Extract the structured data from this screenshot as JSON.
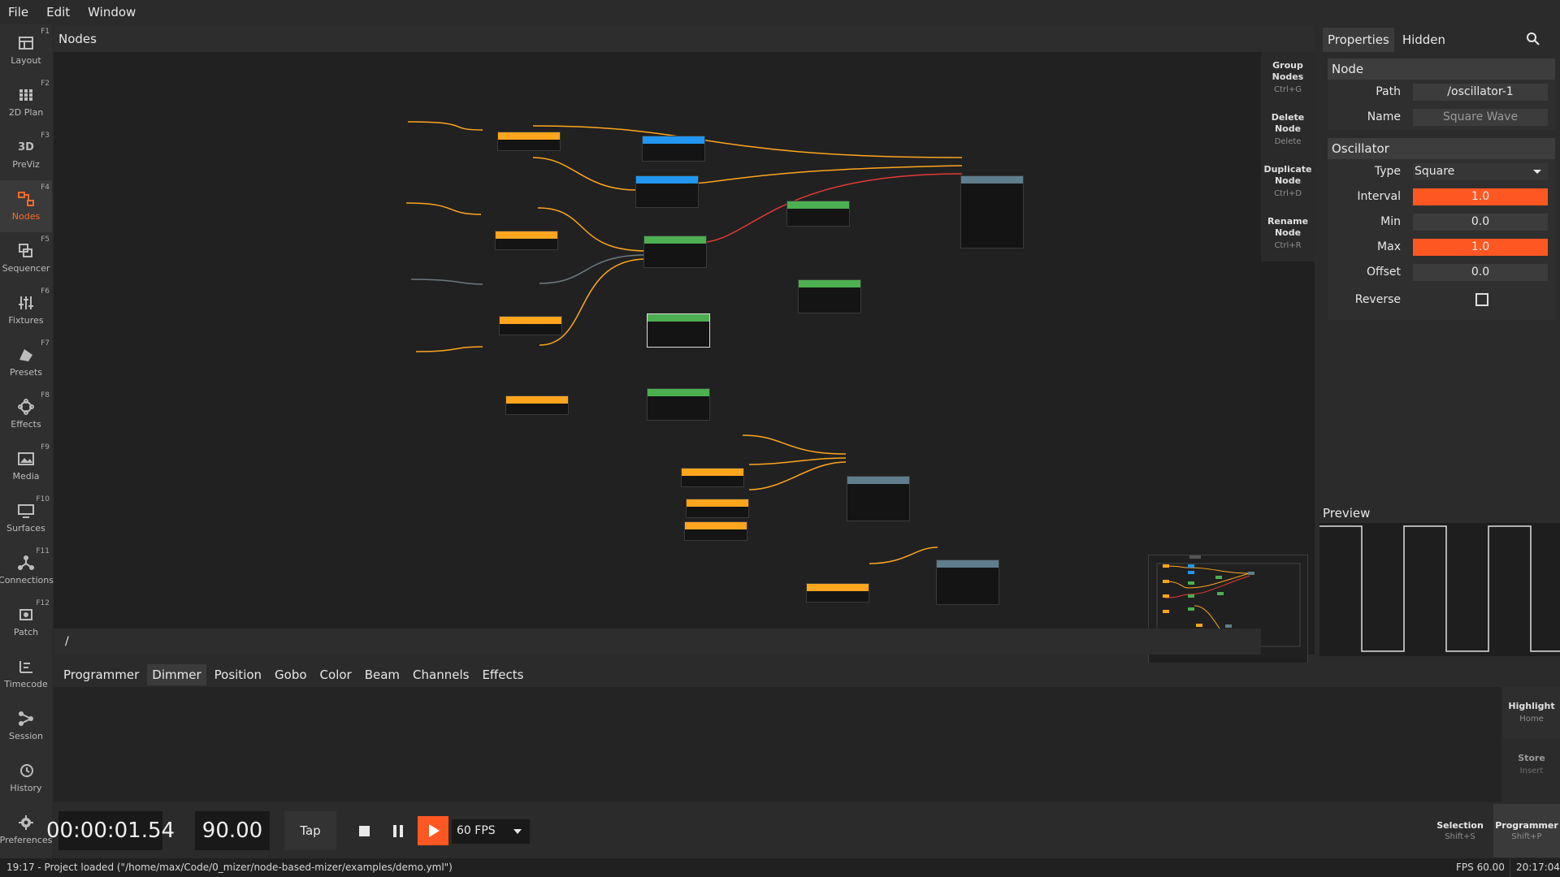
{
  "menu": {
    "file": "File",
    "edit": "Edit",
    "window": "Window"
  },
  "sidebar": {
    "items": [
      {
        "label": "Layout",
        "key": "F1",
        "icon": "layout-icon"
      },
      {
        "label": "2D Plan",
        "key": "F2",
        "icon": "grid-icon"
      },
      {
        "label": "PreViz",
        "key": "F3",
        "icon": "3d-icon",
        "glyph": "3D"
      },
      {
        "label": "Nodes",
        "key": "F4",
        "icon": "nodes-icon"
      },
      {
        "label": "Sequencer",
        "key": "F5",
        "icon": "sequencer-icon"
      },
      {
        "label": "Fixtures",
        "key": "F6",
        "icon": "sliders-icon"
      },
      {
        "label": "Presets",
        "key": "F7",
        "icon": "presets-icon"
      },
      {
        "label": "Effects",
        "key": "F8",
        "icon": "effects-icon"
      },
      {
        "label": "Media",
        "key": "F9",
        "icon": "media-icon"
      },
      {
        "label": "Surfaces",
        "key": "F10",
        "icon": "monitor-icon"
      },
      {
        "label": "Connections",
        "key": "F11",
        "icon": "connections-icon"
      },
      {
        "label": "Patch",
        "key": "F12",
        "icon": "patch-icon"
      },
      {
        "label": "Timecode",
        "key": "",
        "icon": "timecode-icon"
      },
      {
        "label": "Session",
        "key": "",
        "icon": "session-icon"
      },
      {
        "label": "History",
        "key": "",
        "icon": "history-icon"
      },
      {
        "label": "Preferences",
        "key": "",
        "icon": "gear-icon"
      }
    ]
  },
  "nodes": {
    "title": "Nodes",
    "path": "/",
    "actions": [
      {
        "label_1": "Group",
        "label_2": "Nodes",
        "shortcut": "Ctrl+G"
      },
      {
        "label_1": "Delete",
        "label_2": "Node",
        "shortcut": "Delete"
      },
      {
        "label_1": "Duplicate",
        "label_2": "Node",
        "shortcut": "Ctrl+D"
      },
      {
        "label_1": "Rename",
        "label_2": "Node",
        "shortcut": "Ctrl+R"
      }
    ]
  },
  "properties": {
    "tabs": {
      "properties": "Properties",
      "hidden": "Hidden"
    },
    "node_section": {
      "title": "Node",
      "path_label": "Path",
      "path_value": "/oscillator-1",
      "name_label": "Name",
      "name_placeholder": "Square Wave"
    },
    "osc_section": {
      "title": "Oscillator",
      "type_label": "Type",
      "type_value": "Square",
      "interval_label": "Interval",
      "interval_value": "1.0",
      "min_label": "Min",
      "min_value": "0.0",
      "max_label": "Max",
      "max_value": "1.0",
      "offset_label": "Offset",
      "offset_value": "0.0",
      "reverse_label": "Reverse",
      "reverse_checked": false
    }
  },
  "preview": {
    "title": "Preview"
  },
  "programmer": {
    "tabs": [
      "Programmer",
      "Dimmer",
      "Position",
      "Gobo",
      "Color",
      "Beam",
      "Channels",
      "Effects"
    ],
    "active_tab": "Dimmer",
    "highlight": {
      "label": "Highlight",
      "shortcut": "Home"
    },
    "store": {
      "label": "Store",
      "shortcut": "Insert"
    }
  },
  "transport": {
    "time": "00:00:01.54",
    "bpm": "90.00",
    "tap": "Tap",
    "fps": "60 FPS",
    "selection": {
      "label": "Selection",
      "shortcut": "Shift+S"
    },
    "programmer": {
      "label": "Programmer",
      "shortcut": "Shift+P"
    }
  },
  "status": {
    "message": "19:17 - Project loaded (\"/home/max/Code/0_mizer/node-based-mizer/examples/demo.yml\")",
    "fps": "FPS 60.00",
    "clock": "20:17:04"
  },
  "colors": {
    "accent": "#ff5722",
    "node_orange": "#ffa51e",
    "node_blue": "#2196f3",
    "node_green": "#4caf50",
    "node_gray": "#607d8b"
  }
}
